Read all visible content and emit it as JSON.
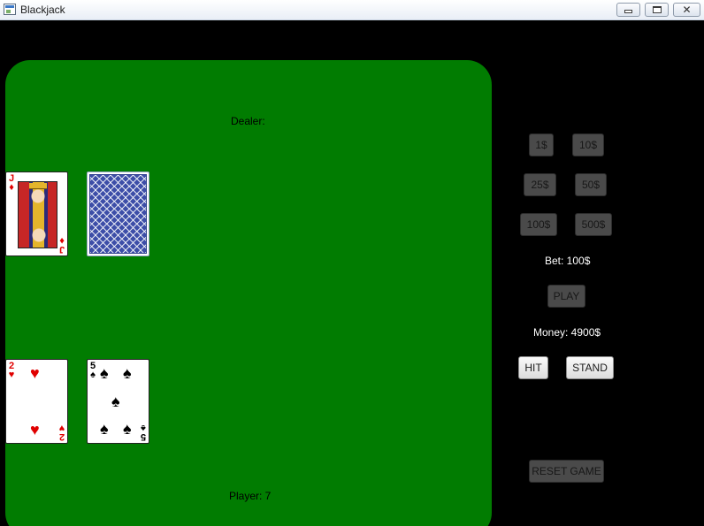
{
  "window": {
    "title": "Blackjack",
    "close_glyph": "✕"
  },
  "table": {
    "color": "#017c01",
    "dealer_label": "Dealer:",
    "player_label": "Player: 7",
    "dealer_cards": [
      {
        "rank": "J",
        "suit": "♦",
        "suit_name": "diamonds",
        "face_up": true
      },
      {
        "face_up": false
      }
    ],
    "player_cards": [
      {
        "rank": "2",
        "suit": "♥",
        "suit_name": "hearts",
        "face_up": true
      },
      {
        "rank": "5",
        "suit": "♠",
        "suit_name": "spades",
        "face_up": true
      }
    ]
  },
  "controls": {
    "bet_buttons": [
      "1$",
      "10$",
      "25$",
      "50$",
      "100$",
      "500$"
    ],
    "bet_text": "Bet: 100$",
    "play_label": "PLAY",
    "money_text": "Money: 4900$",
    "hit_label": "HIT",
    "stand_label": "STAND",
    "reset_label": "RESET GAME"
  }
}
